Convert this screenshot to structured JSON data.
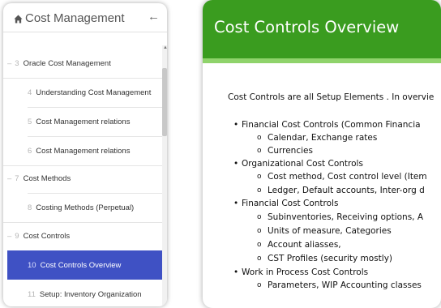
{
  "sidebar": {
    "title": "Cost Management",
    "items": [
      {
        "num": "3",
        "label": "Oracle Cost Management",
        "level": 1
      },
      {
        "num": "4",
        "label": "Understanding Cost Management",
        "level": 2
      },
      {
        "num": "5",
        "label": "Cost Management relations",
        "level": 2
      },
      {
        "num": "6",
        "label": "Cost Management relations",
        "level": 2
      },
      {
        "num": "7",
        "label": "Cost Methods",
        "level": 1
      },
      {
        "num": "8",
        "label": "Costing Methods (Perpetual)",
        "level": 2
      },
      {
        "num": "9",
        "label": "Cost Controls",
        "level": 1
      },
      {
        "num": "10",
        "label": "Cost Controls Overview",
        "level": 2,
        "active": true
      },
      {
        "num": "11",
        "label": "Setup: Inventory Organization",
        "level": 2
      }
    ]
  },
  "slide": {
    "title": "Cost Controls Overview",
    "intro": "Cost Controls are all Setup Elements . In overvie",
    "bullets": [
      {
        "text": "Financial Cost Controls (Common Financia",
        "subs": [
          "Calendar, Exchange rates",
          "Currencies"
        ]
      },
      {
        "text": "Organizational Cost Controls",
        "subs": [
          "Cost method, Cost control level (Item",
          "Ledger, Default accounts, Inter-org d"
        ]
      },
      {
        "text": "Financial Cost Controls",
        "subs": [
          "Subinventories, Receiving options, A",
          "Units of measure, Categories",
          "Account aliasses,",
          "CST Profiles (security mostly)"
        ]
      },
      {
        "text": "Work in Process Cost Controls",
        "subs": [
          "Parameters, WIP Accounting classes"
        ]
      }
    ]
  },
  "colors": {
    "accent_active": "#3f51c4",
    "slide_header": "#3a9c1f",
    "slide_stripe": "#8fd36b"
  },
  "icons": {
    "home": "home-icon",
    "collapse": "arrow-left-icon",
    "scroll_up": "chevron-up-icon"
  }
}
